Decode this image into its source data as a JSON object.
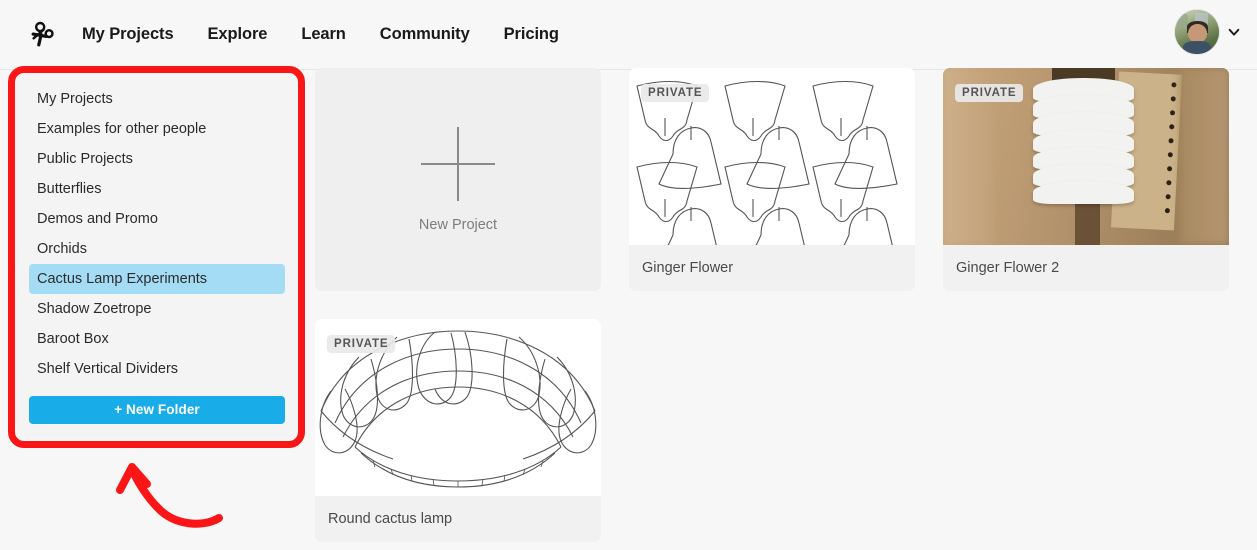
{
  "header": {
    "logo_icon": "scissors-icon",
    "nav": [
      {
        "label": "My Projects"
      },
      {
        "label": "Explore"
      },
      {
        "label": "Learn"
      },
      {
        "label": "Community"
      },
      {
        "label": "Pricing"
      }
    ],
    "account": {
      "avatar_alt": "user avatar",
      "chevron_icon": "chevron-down-icon"
    }
  },
  "sidebar": {
    "items": [
      {
        "label": "My Projects",
        "selected": false
      },
      {
        "label": "Examples for other people",
        "selected": false
      },
      {
        "label": "Public Projects",
        "selected": false
      },
      {
        "label": "Butterflies",
        "selected": false
      },
      {
        "label": "Demos and Promo",
        "selected": false
      },
      {
        "label": "Orchids",
        "selected": false
      },
      {
        "label": "Cactus Lamp Experiments",
        "selected": true
      },
      {
        "label": "Shadow Zoetrope",
        "selected": false
      },
      {
        "label": "Baroot Box",
        "selected": false
      },
      {
        "label": "Shelf Vertical Dividers",
        "selected": false
      }
    ],
    "new_folder_label": "+ New Folder",
    "selected_item": "Cactus Lamp Experiments"
  },
  "annotation": {
    "highlight_shape": "red-rounded-rectangle",
    "arrow_shape": "red-curved-arrow-up"
  },
  "main": {
    "new_project": {
      "label": "New Project",
      "icon": "plus-icon"
    },
    "cards": [
      {
        "title": "Ginger Flower",
        "badge": "PRIVATE",
        "thumb_type": "line-drawing-petals"
      },
      {
        "title": "Ginger Flower 2",
        "badge": "PRIVATE",
        "thumb_type": "photo-paper-sculpture"
      },
      {
        "title": "Round cactus lamp",
        "badge": "PRIVATE",
        "thumb_type": "line-drawing-arc"
      }
    ]
  },
  "colors": {
    "page_bg": "#f7f7f7",
    "accent_blue": "#18ade8",
    "selection_blue": "#a5dcf5",
    "annotation_red": "#fa1616",
    "card_bg": "#efefef"
  }
}
